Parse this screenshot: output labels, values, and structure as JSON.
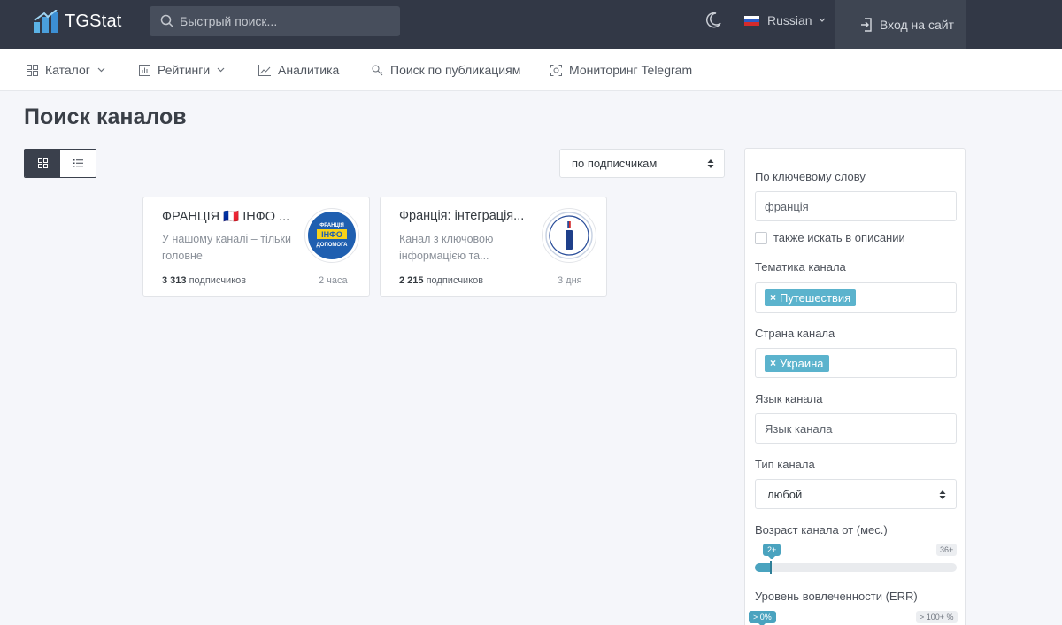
{
  "header": {
    "logo_text": "TGStat",
    "search_placeholder": "Быстрый поиск...",
    "language": "Russian",
    "login_label": "Вход на сайт",
    "colors": {
      "bar": "#323846",
      "accent": "#4aa3bf"
    }
  },
  "nav": {
    "items": [
      {
        "label": "Каталог",
        "icon": "grid-icon",
        "has_dropdown": true
      },
      {
        "label": "Рейтинги",
        "icon": "chart-bar-icon",
        "has_dropdown": true
      },
      {
        "label": "Аналитика",
        "icon": "line-chart-icon",
        "has_dropdown": false
      },
      {
        "label": "Поиск по публикациям",
        "icon": "key-search-icon",
        "has_dropdown": false
      },
      {
        "label": "Мониторинг Telegram",
        "icon": "target-icon",
        "has_dropdown": false
      }
    ]
  },
  "page": {
    "title": "Поиск каналов",
    "sort_selected": "по подписчикам"
  },
  "cards": [
    {
      "title": "ФРАНЦІЯ 🇫🇷 ІНФО ...",
      "description": "У нашому каналі – тільки головне",
      "subscribers_count": "3 313",
      "subscribers_label": "подписчиков",
      "time": "2 часа",
      "avatar_text_top": "ФРАНЦІЯ",
      "avatar_text_mid": "ІНФО",
      "avatar_text_bottom": "ДОПОМОГА"
    },
    {
      "title": "Франція: інтеграція...",
      "description": "Канал з ключовою інформацією та...",
      "subscribers_count": "2 215",
      "subscribers_label": "подписчиков",
      "time": "3 дня"
    }
  ],
  "filters": {
    "keyword_label": "По ключевому слову",
    "keyword_value": "франція",
    "search_in_description_label": "также искать в описании",
    "search_in_description_checked": false,
    "topic_label": "Тематика канала",
    "topic_tag": "Путешествия",
    "country_label": "Страна канала",
    "country_tag": "Украина",
    "language_label": "Язык канала",
    "language_placeholder": "Язык канала",
    "type_label": "Тип канала",
    "type_selected": "любой",
    "age_label": "Возраст канала от (мес.)",
    "age_min_bubble": "2+",
    "age_max_label": "36+",
    "age_value_fraction": 0.08,
    "err_label": "Уровень вовлеченности (ERR)",
    "err_min_bubble": "> 0%",
    "err_max_label": "> 100+ %"
  }
}
